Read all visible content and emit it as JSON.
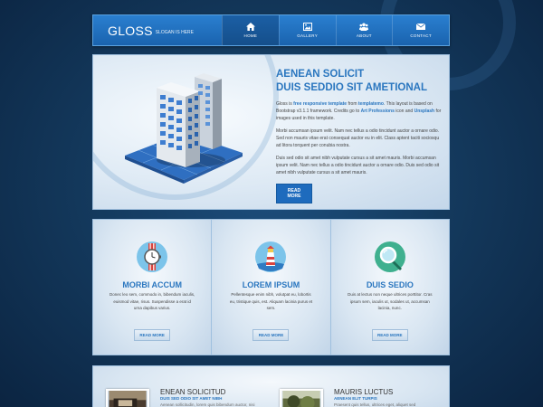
{
  "brand": {
    "name": "GLOSS",
    "slogan": "SLOGAN IS HERE"
  },
  "nav": {
    "items": [
      {
        "label": "HOME",
        "icon": "home-icon",
        "active": true
      },
      {
        "label": "GALLERY",
        "icon": "image-icon",
        "active": false
      },
      {
        "label": "ABOUT",
        "icon": "users-icon",
        "active": false
      },
      {
        "label": "CONTACT",
        "icon": "envelope-icon",
        "active": false
      }
    ]
  },
  "hero": {
    "title_line1": "AENEAN SOLICIT",
    "title_line2": "DUIS SEDDIO SIT AMETIONAL",
    "p1_a": "Gloss is ",
    "p1_link1": "free responsive template",
    "p1_b": " from ",
    "p1_link2": "templatemo",
    "p1_c": ". This layout is based on Bootstrap v3.1.1 framework. Credits go to ",
    "p1_link3": "Art Professions",
    "p1_d": " icon and ",
    "p1_link4": "Unsplash",
    "p1_e": " for images used in this template.",
    "p2": "Morbi accumsan ipsum velit. Nam nec tellus a odio tincidunt auctor a ornare odio. Sed non mauris vitae erat consequat auctor eu in elit. Class aptent taciti sociosqu ad litora torquent per conubia nostra.",
    "p3": "Duis sed odio sit amet nibh vulputate cursus a sit amet mauris. Morbi accumsan ipsum velit. Nam nec tellus a odio tincidunt auctor a ornare odio. Duis sed odio sit amet nibh vulputate cursus a sit amet mauris.",
    "button": "READ MORE"
  },
  "services": [
    {
      "title": "MORBI ACCUM",
      "icon": "watch-icon",
      "text": "Donec leo sem, commodo in, bibendum iaculis, euismod vitae, risus. Suspendisse a erat id urna dapibus varius.",
      "button": "READ MORE"
    },
    {
      "title": "LOREM IPSUM",
      "icon": "lighthouse-icon",
      "text": "Pellentesque enim nibh, volutpat eu, lobortis eu, tristique quis, est. Aliquam lacinia purus et sem.",
      "button": "READ MORE"
    },
    {
      "title": "DUIS SEDIO",
      "icon": "magnifier-icon",
      "text": "Duis at lectus non neque ultrices porttitor. Cras ipsum sem, iaculis ut, sodales ut, accumsan lacinia, nunc.",
      "button": "READ MORE"
    }
  ],
  "posts": [
    {
      "title": "ENEAN SOLICITUD",
      "subtitle": "DUIS SED ODIO SIT AMET NIBH",
      "text": "Aenean sollicitudin, lorem quis bibendum auctor, nisi"
    },
    {
      "title": "MAURIS LUCTUS",
      "subtitle": "AENEAN ELIT TURPIS",
      "text": "Praesent quis tellus, ultrices eget, aliquet sed"
    }
  ],
  "colors": {
    "accent": "#2a76bf",
    "header": "#1e6bbd",
    "background": "#143a5e"
  }
}
